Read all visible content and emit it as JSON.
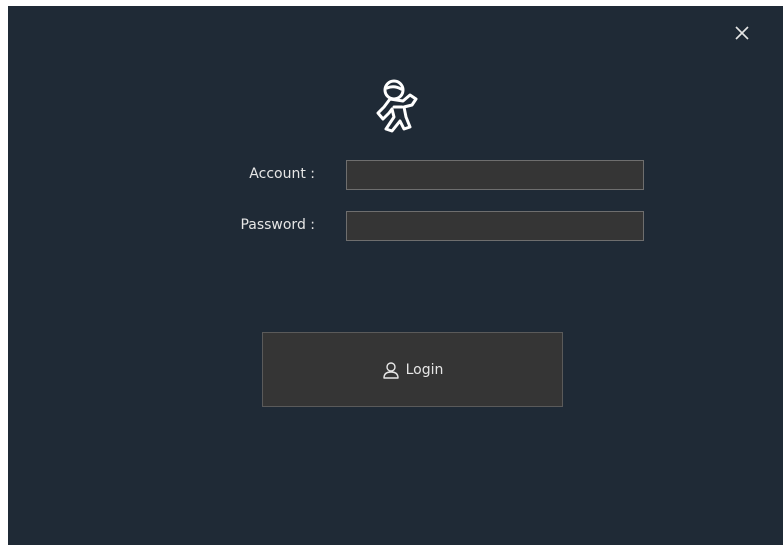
{
  "dialog": {
    "close_icon": "close-icon",
    "logo_icon": "astronaut-logo-icon",
    "account_label": "Account :",
    "account_value": "",
    "password_label": "Password :",
    "password_value": "",
    "login_icon": "user-icon",
    "login_label": "Login"
  },
  "colors": {
    "background": "#1f2a36",
    "input_bg": "#353535",
    "input_border": "#6e6e6e",
    "text": "#e6e6e6"
  }
}
